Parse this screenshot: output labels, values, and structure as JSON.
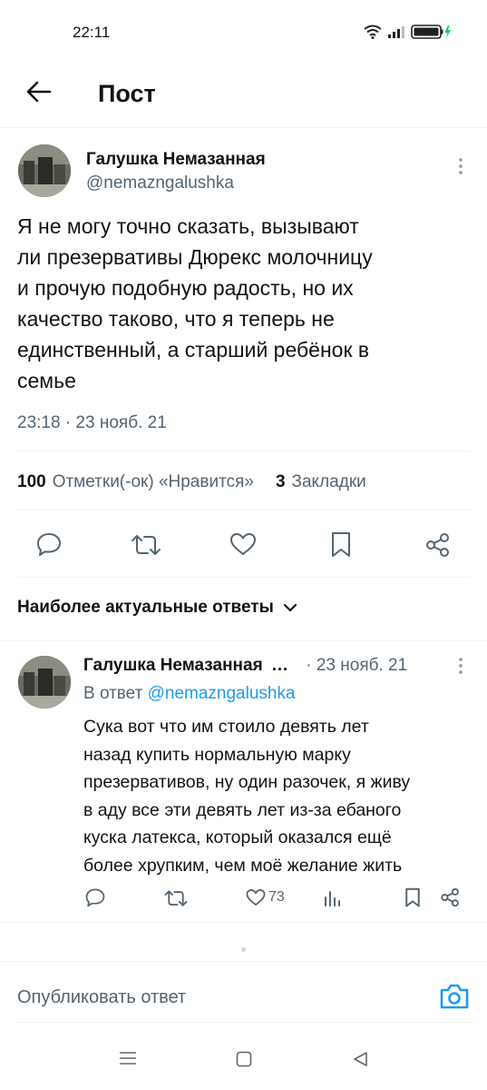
{
  "status_bar": {
    "time": "22:11"
  },
  "header": {
    "title": "Пост"
  },
  "main_tweet": {
    "author_name": "Галушка Немазанная",
    "handle": "@nemazngalushka",
    "text_lines": [
      "Я не могу точно сказать, вызывают",
      "ли презервативы Дюрекс молочницу",
      "и прочую подобную радость, но их",
      "качество таково, что я теперь не",
      "единственный, а старший ребёнок в",
      "семье"
    ],
    "timestamp": "23:18 · 23 нояб. 21",
    "likes_count": "100",
    "likes_label": "Отметки(-ок) «Нравится»",
    "bookmarks_count": "3",
    "bookmarks_label": "Закладки"
  },
  "replies_sort": {
    "label": "Наиболее актуальные ответы"
  },
  "reply": {
    "author_name": "Галушка Немазанная",
    "ellipsis": "…",
    "date": "· 23 нояб. 21",
    "reply_to_prefix": "В ответ",
    "reply_to_handle": "@nemazngalushka",
    "text_lines": [
      "Сука вот что им стоило девять лет",
      "назад купить нормальную марку",
      "презервативов, ну один разочек, я живу",
      "в аду все эти девять лет из-за ебаного",
      "куска латекса, который оказался ещё",
      "более хрупким, чем моё желание жить"
    ],
    "likes": "73"
  },
  "compose": {
    "placeholder": "Опубликовать ответ"
  },
  "colors": {
    "accent": "#1d9bf0",
    "text": "#0f1419",
    "secondary": "#536471",
    "divider": "#eff3f4"
  },
  "icons": [
    "wifi-icon",
    "signal-icon",
    "battery-icon",
    "back-arrow-icon",
    "more-icon",
    "reply-icon",
    "retweet-icon",
    "like-icon",
    "bookmark-icon",
    "share-icon",
    "chevron-down-icon",
    "views-icon",
    "camera-icon",
    "menu-nav-icon",
    "home-nav-icon",
    "back-nav-icon"
  ]
}
